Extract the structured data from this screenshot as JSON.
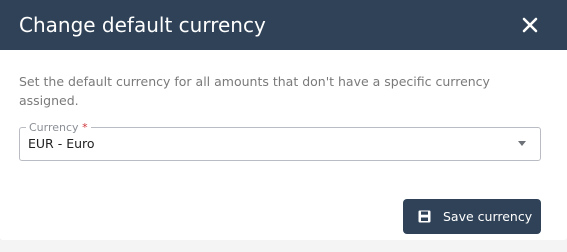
{
  "dialog": {
    "title": "Change default currency",
    "close_icon": "close-icon",
    "description": "Set the default currency for all amounts that don't have a specific currency assigned."
  },
  "currency_field": {
    "label": "Currency",
    "required_marker": "*",
    "value": "EUR - Euro",
    "dropdown_icon": "caret-down-icon"
  },
  "actions": {
    "save_label": "Save currency",
    "save_icon": "floppy-disk-icon"
  },
  "colors": {
    "header_background": "#2f4257",
    "button_background": "#2f4257",
    "required_marker": "#d0343a"
  }
}
